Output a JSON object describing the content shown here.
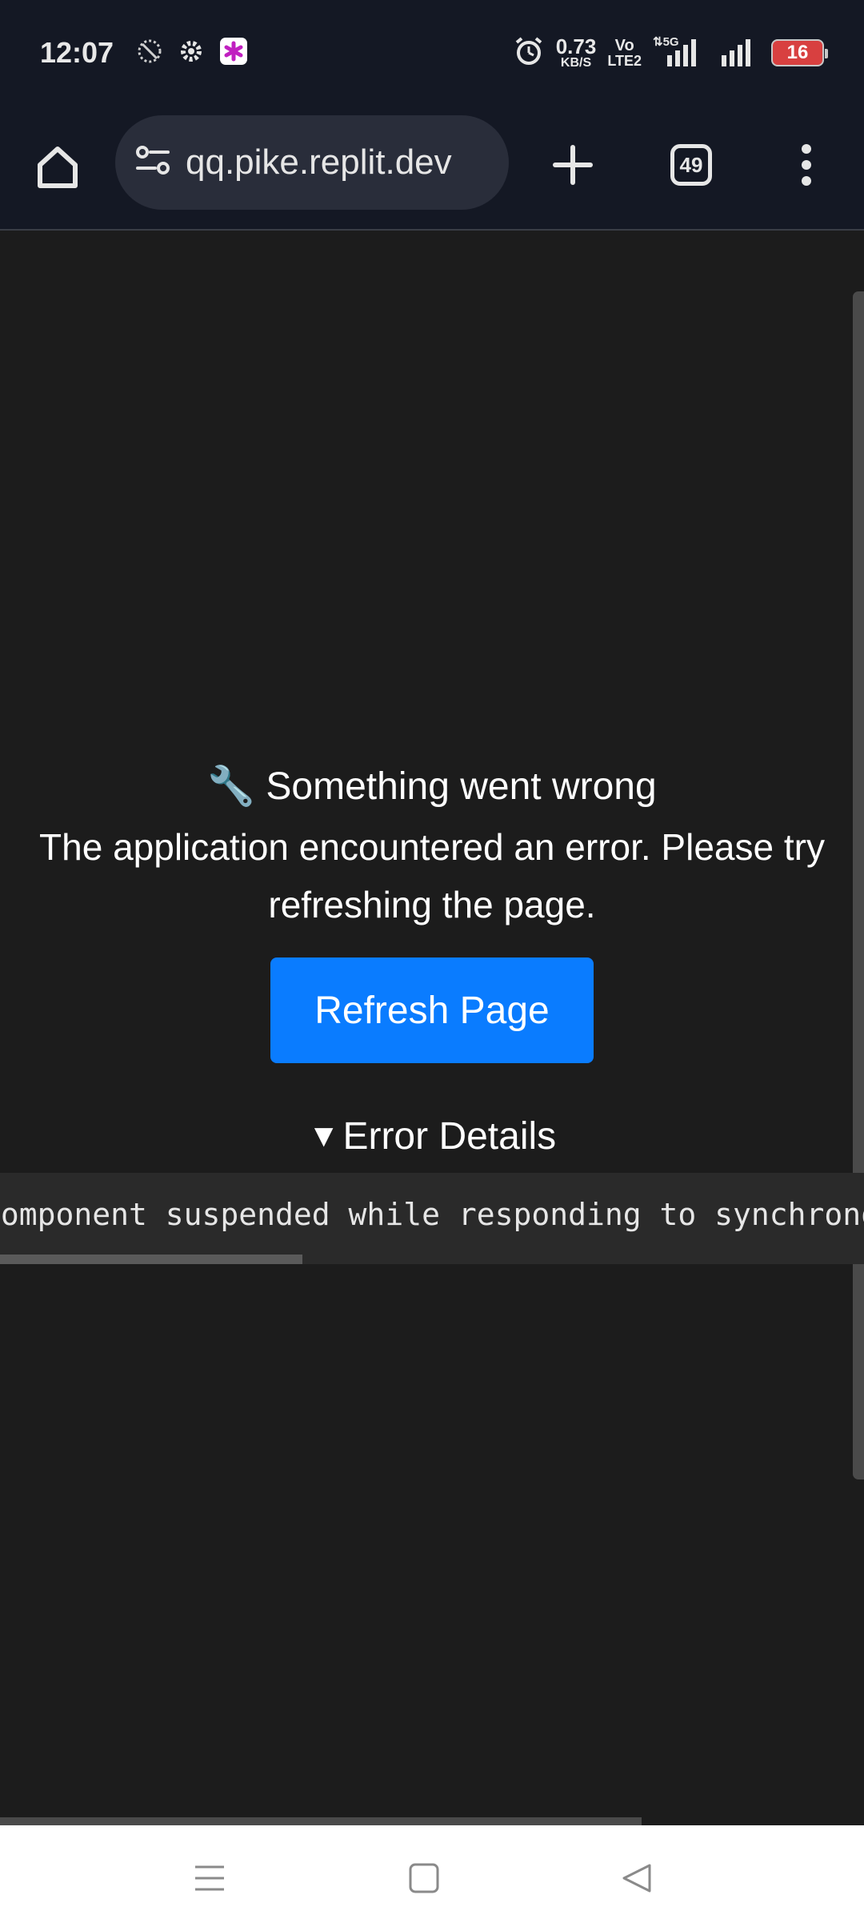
{
  "status_bar": {
    "time": "12:07",
    "net_speed_value": "0.73",
    "net_speed_unit": "KB/S",
    "volte_top": "Vo",
    "volte_bottom": "LTE2",
    "network_type": "5G",
    "battery_level": "16",
    "icons": [
      "no-disturb-icon",
      "settings-gear-icon",
      "app-notification-icon",
      "alarm-icon",
      "signal-icon",
      "signal-icon-2",
      "battery-icon"
    ]
  },
  "browser": {
    "url": "qq.pike.replit.dev",
    "tab_count": "49",
    "icons": [
      "home-icon",
      "site-settings-icon",
      "new-tab-plus-icon",
      "tab-switcher-icon",
      "more-vert-icon"
    ]
  },
  "page": {
    "error_icon": "🔧",
    "error_title": "Something went wrong",
    "error_message": "The application encountered an error. Please try refreshing the page.",
    "refresh_button_label": "Refresh Page",
    "details_toggle": "▼",
    "details_label": "Error Details",
    "error_detail_text": "component suspended while responding to synchronous input"
  },
  "nav_bar": {
    "icons": [
      "recent-apps-icon",
      "home-square-icon",
      "back-triangle-icon"
    ]
  },
  "colors": {
    "status_bg": "#141824",
    "page_bg": "#1c1c1c",
    "button_blue": "#0a7cff",
    "pre_bg": "#2a2a2a",
    "battery_red": "#d84040"
  }
}
